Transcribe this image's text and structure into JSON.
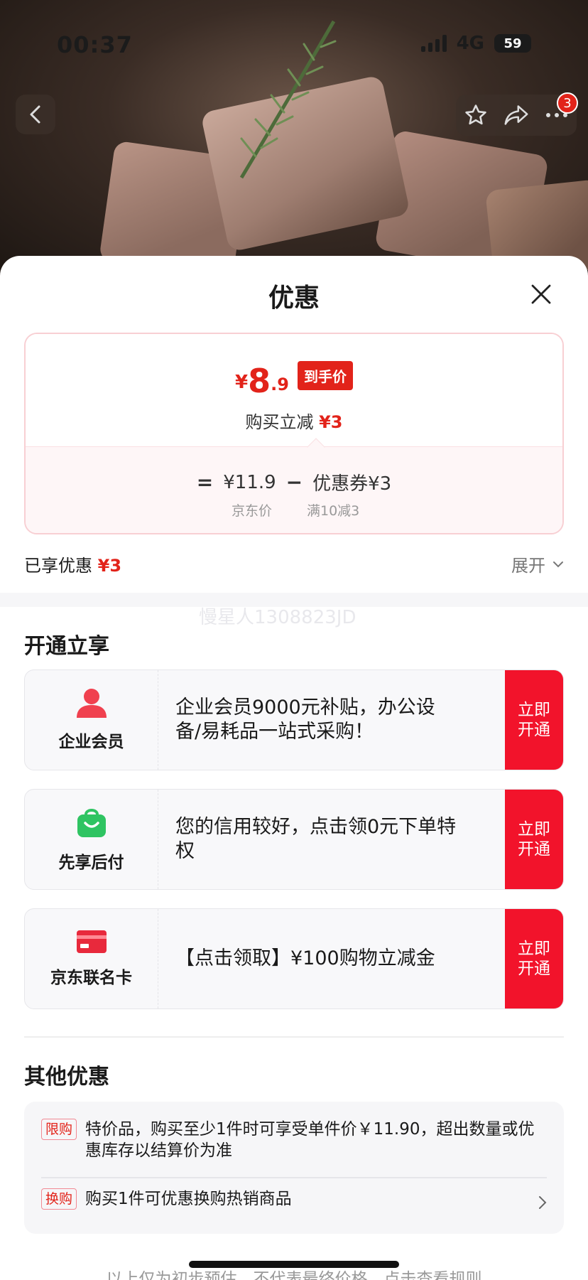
{
  "status_bar": {
    "time": "00:37",
    "network": "4G",
    "battery": "59"
  },
  "nav": {
    "cart_badge": "3"
  },
  "sheet": {
    "title": "优惠",
    "price_card": {
      "currency": "¥",
      "price_int": "8",
      "price_dec": ".9",
      "price_tag": "到手价",
      "reduce_label": "购买立减",
      "reduce_value": "¥3",
      "eq": "=",
      "jd_price": "¥11.9",
      "minus": "−",
      "coupon": "优惠券¥3",
      "jd_price_label": "京东价",
      "coupon_rule": "满10减3"
    },
    "enjoyed": {
      "label": "已享优惠",
      "value": "¥3"
    },
    "expand_label": "展开",
    "watermark": "慢星人1308823JD",
    "open_section": {
      "title": "开通立享",
      "items": [
        {
          "label": "企业会员",
          "desc": "企业会员9000元补贴，办公设备/易耗品一站式采购！",
          "button": "立即开通"
        },
        {
          "label": "先享后付",
          "desc": "您的信用较好，点击领0元下单特权",
          "button": "立即开通"
        },
        {
          "label": "京东联名卡",
          "desc": "【点击领取】¥100购物立减金",
          "button": "立即开通"
        }
      ]
    },
    "other_section": {
      "title": "其他优惠",
      "items": [
        {
          "tag": "限购",
          "text": "特价品，购买至少1件时可享受单件价￥11.90，超出数量或优惠库存以结算价为准"
        },
        {
          "tag": "换购",
          "text": "购买1件可优惠换购热销商品"
        }
      ]
    },
    "footnote": "以上仅为初步预估，不代表最终价格，点击查看规则"
  },
  "colors": {
    "accent_red": "#e2231a",
    "button_red": "#f2132b",
    "pay_green": "#2fc462",
    "member_red": "#f0414f",
    "card_red": "#e8293c"
  }
}
